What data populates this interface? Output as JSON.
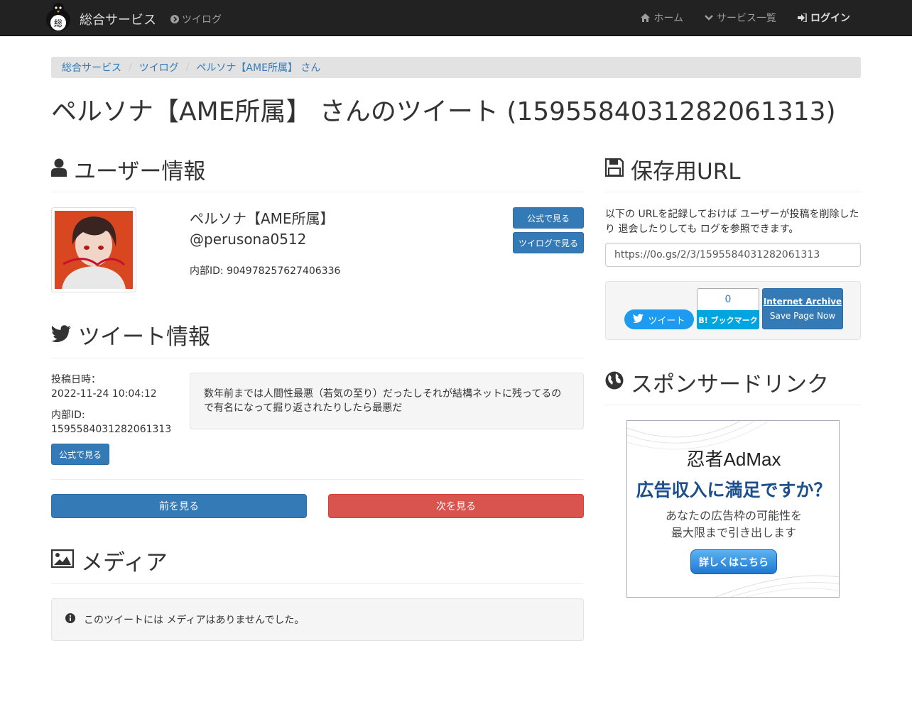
{
  "navbar": {
    "brand": "総合サービス",
    "logo_char": "総",
    "twilog": "ツイログ",
    "home": "ホーム",
    "services": "サービス一覧",
    "login": "ログイン"
  },
  "breadcrumb": [
    "総合サービス",
    "ツイログ",
    "ペルソナ【AME所属】 さん"
  ],
  "page_title": "ペルソナ【AME所属】 さんのツイート (1595584031282061313)",
  "user_info": {
    "heading": "ユーザー情報",
    "display_name": "ペルソナ【AME所属】",
    "handle": "@perusona0512",
    "internal_id": "内部ID: 904978257627406336",
    "btn_official": "公式で見る",
    "btn_twilog": "ツイログで見る"
  },
  "tweet_info": {
    "heading": "ツイート情報",
    "posted_label": "投稿日時：",
    "posted_value": "2022-11-24 10:04:12",
    "internal_label": "内部ID:",
    "internal_value": "1595584031282061313",
    "btn_official": "公式で見る",
    "text": "数年前までは人間性最悪（若気の至り）だったしそれが結構ネットに残ってるので有名になって掘り返されたりしたら最悪だ"
  },
  "pager": {
    "prev": "前を見る",
    "next": "次を見る"
  },
  "media": {
    "heading": "メディア",
    "empty": "このツイートには メディアはありませんでした。"
  },
  "save_url": {
    "heading": "保存用URL",
    "description": "以下の URLを記録しておけば ユーザーが投稿を削除したり 退会したりしても ログを参照できます。",
    "url": "https://0o.gs/2/3/1595584031282061313"
  },
  "share": {
    "tweet": "ツイート",
    "hatena_count": "0",
    "hatena_label": "B! ブックマーク",
    "ia_title": "Internet Archive",
    "ia_sub": "Save Page Now"
  },
  "sponsor": {
    "heading": "スポンサードリンク",
    "ad_logo": "忍者AdMax",
    "ad_headline": "広告収入に満足ですか？",
    "ad_line1": "あなたの広告枠の可能性を",
    "ad_line2": "最大限まで引き出します",
    "ad_button": "詳しくはこちら"
  },
  "colors": {
    "navbar_bg": "#222222",
    "primary": "#337ab7",
    "danger": "#d9534f",
    "twitter": "#1d9bf0",
    "hatena": "#00a4de"
  }
}
